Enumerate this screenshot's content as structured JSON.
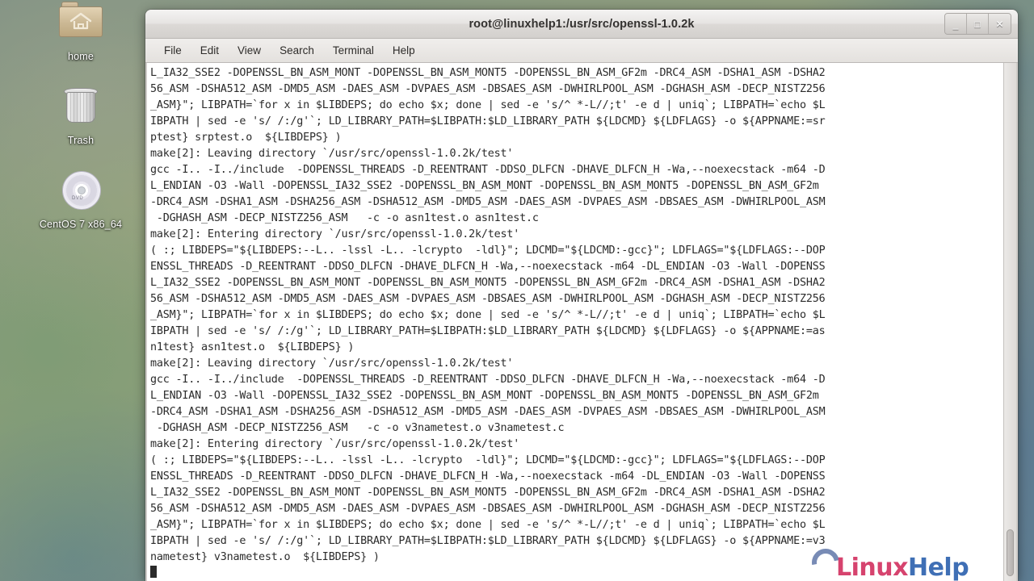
{
  "desktop": {
    "icons": [
      {
        "label": "home",
        "icon": "folder-home-icon"
      },
      {
        "label": "Trash",
        "icon": "trash-icon"
      },
      {
        "label": "CentOS 7 x86_64",
        "icon": "dvd-disc-icon"
      }
    ]
  },
  "window": {
    "title": "root@linuxhelp1:/usr/src/openssl-1.0.2k",
    "controls": {
      "minimize": "_",
      "maximize": "□",
      "close": "✕"
    },
    "menu": [
      "File",
      "Edit",
      "View",
      "Search",
      "Terminal",
      "Help"
    ]
  },
  "terminal": {
    "cursor": "block",
    "lines": [
      "L_IA32_SSE2 -DOPENSSL_BN_ASM_MONT -DOPENSSL_BN_ASM_MONT5 -DOPENSSL_BN_ASM_GF2m -DRC4_ASM -DSHA1_ASM -DSHA2",
      "56_ASM -DSHA512_ASM -DMD5_ASM -DAES_ASM -DVPAES_ASM -DBSAES_ASM -DWHIRLPOOL_ASM -DGHASH_ASM -DECP_NISTZ256",
      "_ASM}\"; LIBPATH=`for x in $LIBDEPS; do echo $x; done | sed -e 's/^ *-L//;t' -e d | uniq`; LIBPATH=`echo $L",
      "IBPATH | sed -e 's/ /:/g'`; LD_LIBRARY_PATH=$LIBPATH:$LD_LIBRARY_PATH ${LDCMD} ${LDFLAGS} -o ${APPNAME:=sr",
      "ptest} srptest.o  ${LIBDEPS} )",
      "make[2]: Leaving directory `/usr/src/openssl-1.0.2k/test'",
      "gcc -I.. -I../include  -DOPENSSL_THREADS -D_REENTRANT -DDSO_DLFCN -DHAVE_DLFCN_H -Wa,--noexecstack -m64 -D",
      "L_ENDIAN -O3 -Wall -DOPENSSL_IA32_SSE2 -DOPENSSL_BN_ASM_MONT -DOPENSSL_BN_ASM_MONT5 -DOPENSSL_BN_ASM_GF2m",
      "-DRC4_ASM -DSHA1_ASM -DSHA256_ASM -DSHA512_ASM -DMD5_ASM -DAES_ASM -DVPAES_ASM -DBSAES_ASM -DWHIRLPOOL_ASM",
      " -DGHASH_ASM -DECP_NISTZ256_ASM   -c -o asn1test.o asn1test.c",
      "make[2]: Entering directory `/usr/src/openssl-1.0.2k/test'",
      "( :; LIBDEPS=\"${LIBDEPS:--L.. -lssl -L.. -lcrypto  -ldl}\"; LDCMD=\"${LDCMD:-gcc}\"; LDFLAGS=\"${LDFLAGS:--DOP",
      "ENSSL_THREADS -D_REENTRANT -DDSO_DLFCN -DHAVE_DLFCN_H -Wa,--noexecstack -m64 -DL_ENDIAN -O3 -Wall -DOPENSS",
      "L_IA32_SSE2 -DOPENSSL_BN_ASM_MONT -DOPENSSL_BN_ASM_MONT5 -DOPENSSL_BN_ASM_GF2m -DRC4_ASM -DSHA1_ASM -DSHA2",
      "56_ASM -DSHA512_ASM -DMD5_ASM -DAES_ASM -DVPAES_ASM -DBSAES_ASM -DWHIRLPOOL_ASM -DGHASH_ASM -DECP_NISTZ256",
      "_ASM}\"; LIBPATH=`for x in $LIBDEPS; do echo $x; done | sed -e 's/^ *-L//;t' -e d | uniq`; LIBPATH=`echo $L",
      "IBPATH | sed -e 's/ /:/g'`; LD_LIBRARY_PATH=$LIBPATH:$LD_LIBRARY_PATH ${LDCMD} ${LDFLAGS} -o ${APPNAME:=as",
      "n1test} asn1test.o  ${LIBDEPS} )",
      "make[2]: Leaving directory `/usr/src/openssl-1.0.2k/test'",
      "gcc -I.. -I../include  -DOPENSSL_THREADS -D_REENTRANT -DDSO_DLFCN -DHAVE_DLFCN_H -Wa,--noexecstack -m64 -D",
      "L_ENDIAN -O3 -Wall -DOPENSSL_IA32_SSE2 -DOPENSSL_BN_ASM_MONT -DOPENSSL_BN_ASM_MONT5 -DOPENSSL_BN_ASM_GF2m",
      "-DRC4_ASM -DSHA1_ASM -DSHA256_ASM -DSHA512_ASM -DMD5_ASM -DAES_ASM -DVPAES_ASM -DBSAES_ASM -DWHIRLPOOL_ASM",
      " -DGHASH_ASM -DECP_NISTZ256_ASM   -c -o v3nametest.o v3nametest.c",
      "make[2]: Entering directory `/usr/src/openssl-1.0.2k/test'",
      "( :; LIBDEPS=\"${LIBDEPS:--L.. -lssl -L.. -lcrypto  -ldl}\"; LDCMD=\"${LDCMD:-gcc}\"; LDFLAGS=\"${LDFLAGS:--DOP",
      "ENSSL_THREADS -D_REENTRANT -DDSO_DLFCN -DHAVE_DLFCN_H -Wa,--noexecstack -m64 -DL_ENDIAN -O3 -Wall -DOPENSS",
      "L_IA32_SSE2 -DOPENSSL_BN_ASM_MONT -DOPENSSL_BN_ASM_MONT5 -DOPENSSL_BN_ASM_GF2m -DRC4_ASM -DSHA1_ASM -DSHA2",
      "56_ASM -DSHA512_ASM -DMD5_ASM -DAES_ASM -DVPAES_ASM -DBSAES_ASM -DWHIRLPOOL_ASM -DGHASH_ASM -DECP_NISTZ256",
      "_ASM}\"; LIBPATH=`for x in $LIBDEPS; do echo $x; done | sed -e 's/^ *-L//;t' -e d | uniq`; LIBPATH=`echo $L",
      "IBPATH | sed -e 's/ /:/g'`; LD_LIBRARY_PATH=$LIBPATH:$LD_LIBRARY_PATH ${LDCMD} ${LDFLAGS} -o ${APPNAME:=v3",
      "nametest} v3nametest.o  ${LIBDEPS} )"
    ]
  },
  "watermark": {
    "part1": "Linux",
    "part2": "Help"
  },
  "colors": {
    "terminal_bg": "#ffffff",
    "terminal_fg": "#2b2b2b",
    "titlebar": "#e6e4e2",
    "watermark_pink": "#d6436e",
    "watermark_blue": "#3f6fb5"
  }
}
